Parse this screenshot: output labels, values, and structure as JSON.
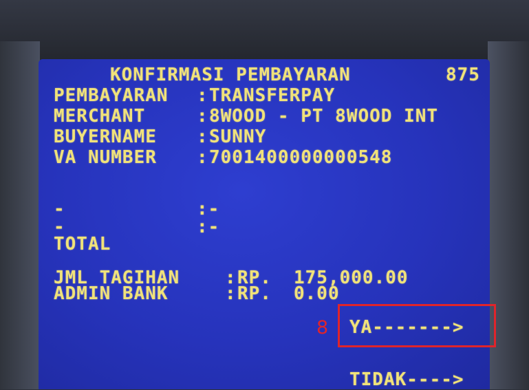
{
  "screen": {
    "title": "KONFIRMASI PEMBAYARAN",
    "code": "875",
    "rows": [
      {
        "label": "PEMBAYARAN",
        "sep": ":",
        "value": "TRANSFERPAY"
      },
      {
        "label": "MERCHANT",
        "sep": ":",
        "value": "8WOOD - PT 8WOOD INT"
      },
      {
        "label": "BUYERNAME",
        "sep": ":",
        "value": "SUNNY"
      },
      {
        "label": "VA NUMBER",
        "sep": ":",
        "value": "7001400000000548"
      },
      {
        "label": "-",
        "sep": ":-",
        "value": ""
      },
      {
        "label": "-",
        "sep": ":-",
        "value": ""
      }
    ],
    "total_label": "TOTAL",
    "amounts": [
      {
        "label": "JML TAGIHAN",
        "sep": ":",
        "currency": "RP.",
        "value": "175,000.00"
      },
      {
        "label": "ADMIN BANK",
        "sep": ":",
        "currency": "RP.",
        "value": "0.00"
      }
    ],
    "options": {
      "yes": "YA------->",
      "no": "TIDAK---->"
    }
  },
  "annotation": {
    "marker": "8",
    "color": "#e0242a"
  },
  "colors": {
    "screen_bg": "#2633bb",
    "text": "#f0e27a",
    "bezel": "#2c3038"
  }
}
